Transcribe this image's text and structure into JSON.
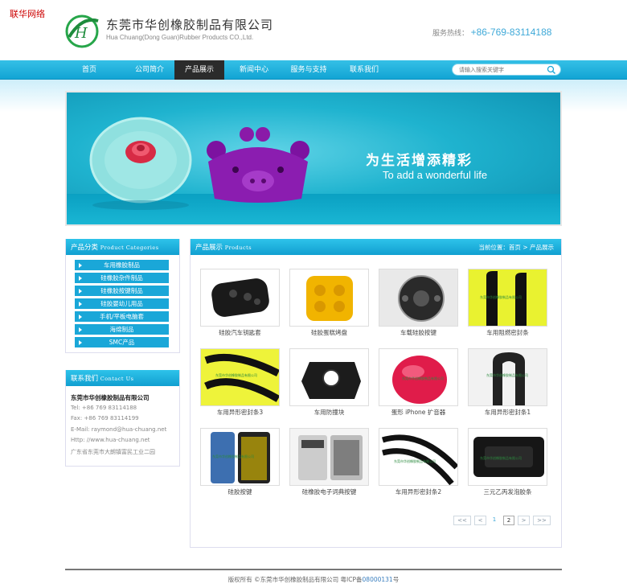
{
  "watermark": "联华网络",
  "header": {
    "company_cn": "东莞市华创橡胶制品有限公司",
    "company_en": "Hua Chuang(Dong Guan)Rubber Products CO.,Ltd.",
    "hotline_label": "服务热线：",
    "hotline_number": "+86-769-83114188"
  },
  "nav": {
    "items": [
      "首页",
      "公司简介",
      "产品展示",
      "新闻中心",
      "服务与支持",
      "联系我们"
    ],
    "active_index": 2,
    "search_placeholder": "请输入搜索关键字"
  },
  "banner": {
    "cn": "为生活增添精彩",
    "en": "To add a wonderful life"
  },
  "categories": {
    "title": "产品分类",
    "title_en": "Product Categories",
    "items": [
      "车用橡胶制品",
      "硅橡胶杂件制品",
      "硅橡胶按键制品",
      "硅胶婴幼儿用品",
      "手机/平板电脑套",
      "海绵制品",
      "SMC产品"
    ]
  },
  "contact": {
    "title": "联系我们",
    "title_en": "Contact Us",
    "company": "东莞市华创橡胶制品有限公司",
    "tel": "Tel: +86 769 83114188",
    "fax": "Fax: +86 769 83114199",
    "email": "E-Mail: raymond@hua-chuang.net",
    "http": "Http: //www.hua-chuang.net",
    "address": "广东省东莞市大朗镇富民工业二园"
  },
  "products": {
    "title": "产品展示",
    "title_en": "Products",
    "crumb": "当前位置：首页 > 产品展示",
    "items": [
      "硅胶汽车钥匙套",
      "硅胶蛋糕烤盘",
      "车载硅胶按键",
      "车用阻燃密封条",
      "车用异形密封条3",
      "车用防撞块",
      "蛋形 iPhone 扩音器",
      "车用异形密封条1",
      "硅胶按键",
      "硅橡胶电子词典按键",
      "车用异形密封条2",
      "三元乙丙发泡胶条"
    ],
    "overlay_text": "东莞市华创橡胶制品有限公司"
  },
  "pagination": {
    "first": "<<",
    "prev": "<",
    "pages": [
      "1",
      "2"
    ],
    "current": "2",
    "next": ">",
    "last": ">>"
  },
  "footer": {
    "text": "版权所有 ©东莞市华创橡胶制品有限公司 粤ICP备",
    "icp": "08000131",
    "suffix": "号"
  },
  "colors": {
    "nav_bg": "#1aa7d8",
    "nav_active": "#2b2b2b",
    "hotline": "#3fa9d8",
    "watermark": "#cc0000"
  }
}
